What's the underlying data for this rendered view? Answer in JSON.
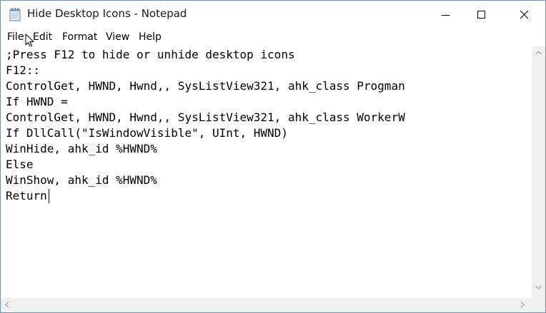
{
  "window": {
    "title": "Hide Desktop Icons - Notepad",
    "app_icon": "notepad-icon"
  },
  "title_buttons": {
    "minimize_icon": "minimize-icon",
    "maximize_icon": "maximize-icon",
    "close_icon": "close-icon"
  },
  "menu": {
    "items": [
      {
        "label": "File"
      },
      {
        "label": "Edit"
      },
      {
        "label": "Format"
      },
      {
        "label": "View"
      },
      {
        "label": "Help"
      }
    ]
  },
  "editor": {
    "lines": [
      ";Press F12 to hide or unhide desktop icons",
      "F12::",
      "ControlGet, HWND, Hwnd,, SysListView321, ahk_class Progman",
      "If HWND =",
      "ControlGet, HWND, Hwnd,, SysListView321, ahk_class WorkerW",
      "If DllCall(\"IsWindowVisible\", UInt, HWND)",
      "WinHide, ahk_id %HWND%",
      "Else",
      "WinShow, ahk_id %HWND%",
      "Return"
    ]
  },
  "colors": {
    "border": "#7a8fa6",
    "scrollbar": "#f0f0f0",
    "text": "#000000"
  }
}
